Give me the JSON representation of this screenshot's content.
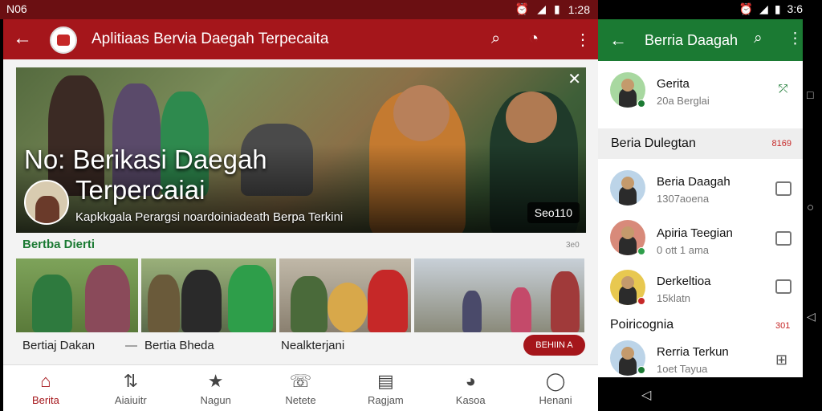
{
  "left_status": {
    "time": "N06",
    "clock": "1:28"
  },
  "left_appbar": {
    "title": "Aplitiaas Bervia Daegah Terpecaita"
  },
  "hero": {
    "headline_1": "No: Berikasi Daegah",
    "headline_2": "Terpercaiai",
    "subtitle": "Kapkkgala Perargsi noardoiniadeath Berpa Terkini",
    "badge": "Seo110"
  },
  "section": {
    "title": "Bertba Dierti",
    "more": "3e0"
  },
  "thumb_captions": [
    "Bertiaj Dakan",
    "Bertia Bheda",
    "Nealkterjani"
  ],
  "dash": "—",
  "read_button": "BEHIIN A",
  "bottom_nav": [
    {
      "label": "Berita",
      "icon": "home-icon",
      "glyph": "⌂"
    },
    {
      "label": "Aiaiuitr",
      "icon": "transfer-icon",
      "glyph": "⇅"
    },
    {
      "label": "Nagun",
      "icon": "star-icon",
      "glyph": "★"
    },
    {
      "label": "Netete",
      "icon": "phone-icon",
      "glyph": "☏"
    },
    {
      "label": "Ragjam",
      "icon": "news-icon",
      "glyph": "▤"
    },
    {
      "label": "Kasoa",
      "icon": "chat-icon",
      "glyph": "◕"
    },
    {
      "label": "Henani",
      "icon": "profile-icon",
      "glyph": "◯"
    }
  ],
  "right_status": {
    "clock": "3:6"
  },
  "right_appbar": {
    "title": "Berria Daagah"
  },
  "right_top": {
    "name": "Gerita",
    "sub": "20a Berglai"
  },
  "right_section1": {
    "title": "Beria Dulegtan",
    "count": "8169"
  },
  "right_items": [
    {
      "name": "Beria Daagah",
      "sub": "1307aoena",
      "dot": "#1b7a33"
    },
    {
      "name": "Apiria Teegian",
      "sub": "0 ott 1 ama",
      "dot": "#2e9e4a"
    },
    {
      "name": "Derkeltioa",
      "sub": "15klatn",
      "dot": "#c62828"
    }
  ],
  "right_section2": {
    "title": "Poiricognia",
    "count": "301"
  },
  "right_bottom": {
    "name": "Rerria Terkun",
    "sub": "1oet Tayua"
  },
  "colors": {
    "primary": "#a5161b",
    "green": "#1b7a33"
  }
}
